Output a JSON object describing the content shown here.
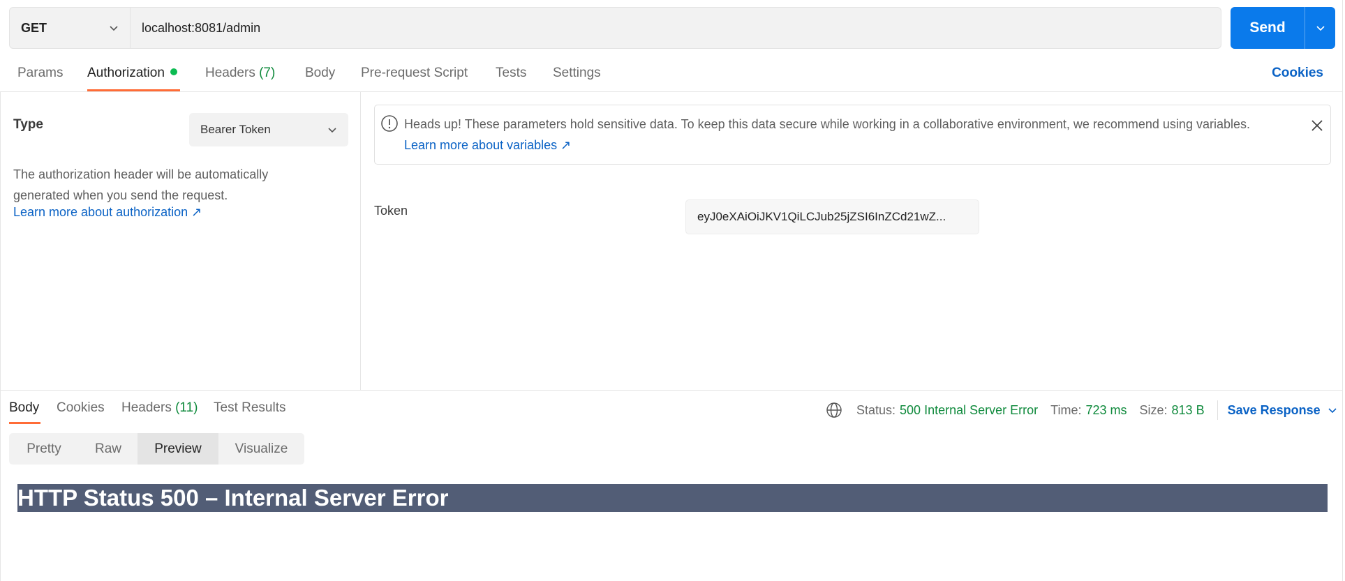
{
  "request": {
    "method": "GET",
    "url": "localhost:8081/admin",
    "send_label": "Send"
  },
  "request_tabs": [
    {
      "label": "Params"
    },
    {
      "label": "Authorization"
    },
    {
      "label": "Headers",
      "count": "(7)"
    },
    {
      "label": "Body"
    },
    {
      "label": "Pre-request Script"
    },
    {
      "label": "Tests"
    },
    {
      "label": "Settings"
    }
  ],
  "cookies_label": "Cookies",
  "auth": {
    "type_label": "Type",
    "type_value": "Bearer Token",
    "description": "The authorization header will be automatically generated when you send the request.",
    "learn_link": "Learn more about authorization ↗",
    "notice_text": "Heads up! These parameters hold sensitive data. To keep this data secure while working in a collaborative environment, we recommend using variables.",
    "notice_link": "Learn more about variables ↗",
    "token_label": "Token",
    "token_value": "eyJ0eXAiOiJKV1QiLCJub25jZSI6InZCd21wZ..."
  },
  "response": {
    "tabs": [
      {
        "label": "Body"
      },
      {
        "label": "Cookies"
      },
      {
        "label": "Headers",
        "count": "(11)"
      },
      {
        "label": "Test Results"
      }
    ],
    "status_key": "Status:",
    "status_value": "500 Internal Server Error",
    "time_key": "Time:",
    "time_value": "723 ms",
    "size_key": "Size:",
    "size_value": "813 B",
    "save_label": "Save Response",
    "view_modes": [
      "Pretty",
      "Raw",
      "Preview",
      "Visualize"
    ],
    "active_view": "Preview",
    "preview_heading": "HTTP Status 500 – Internal Server Error"
  },
  "colors": {
    "accent": "#ff6c37",
    "send": "#0a7aeb",
    "link": "#0a62c5",
    "success": "#0f8a3c",
    "error_header_bg": "#525d76"
  }
}
